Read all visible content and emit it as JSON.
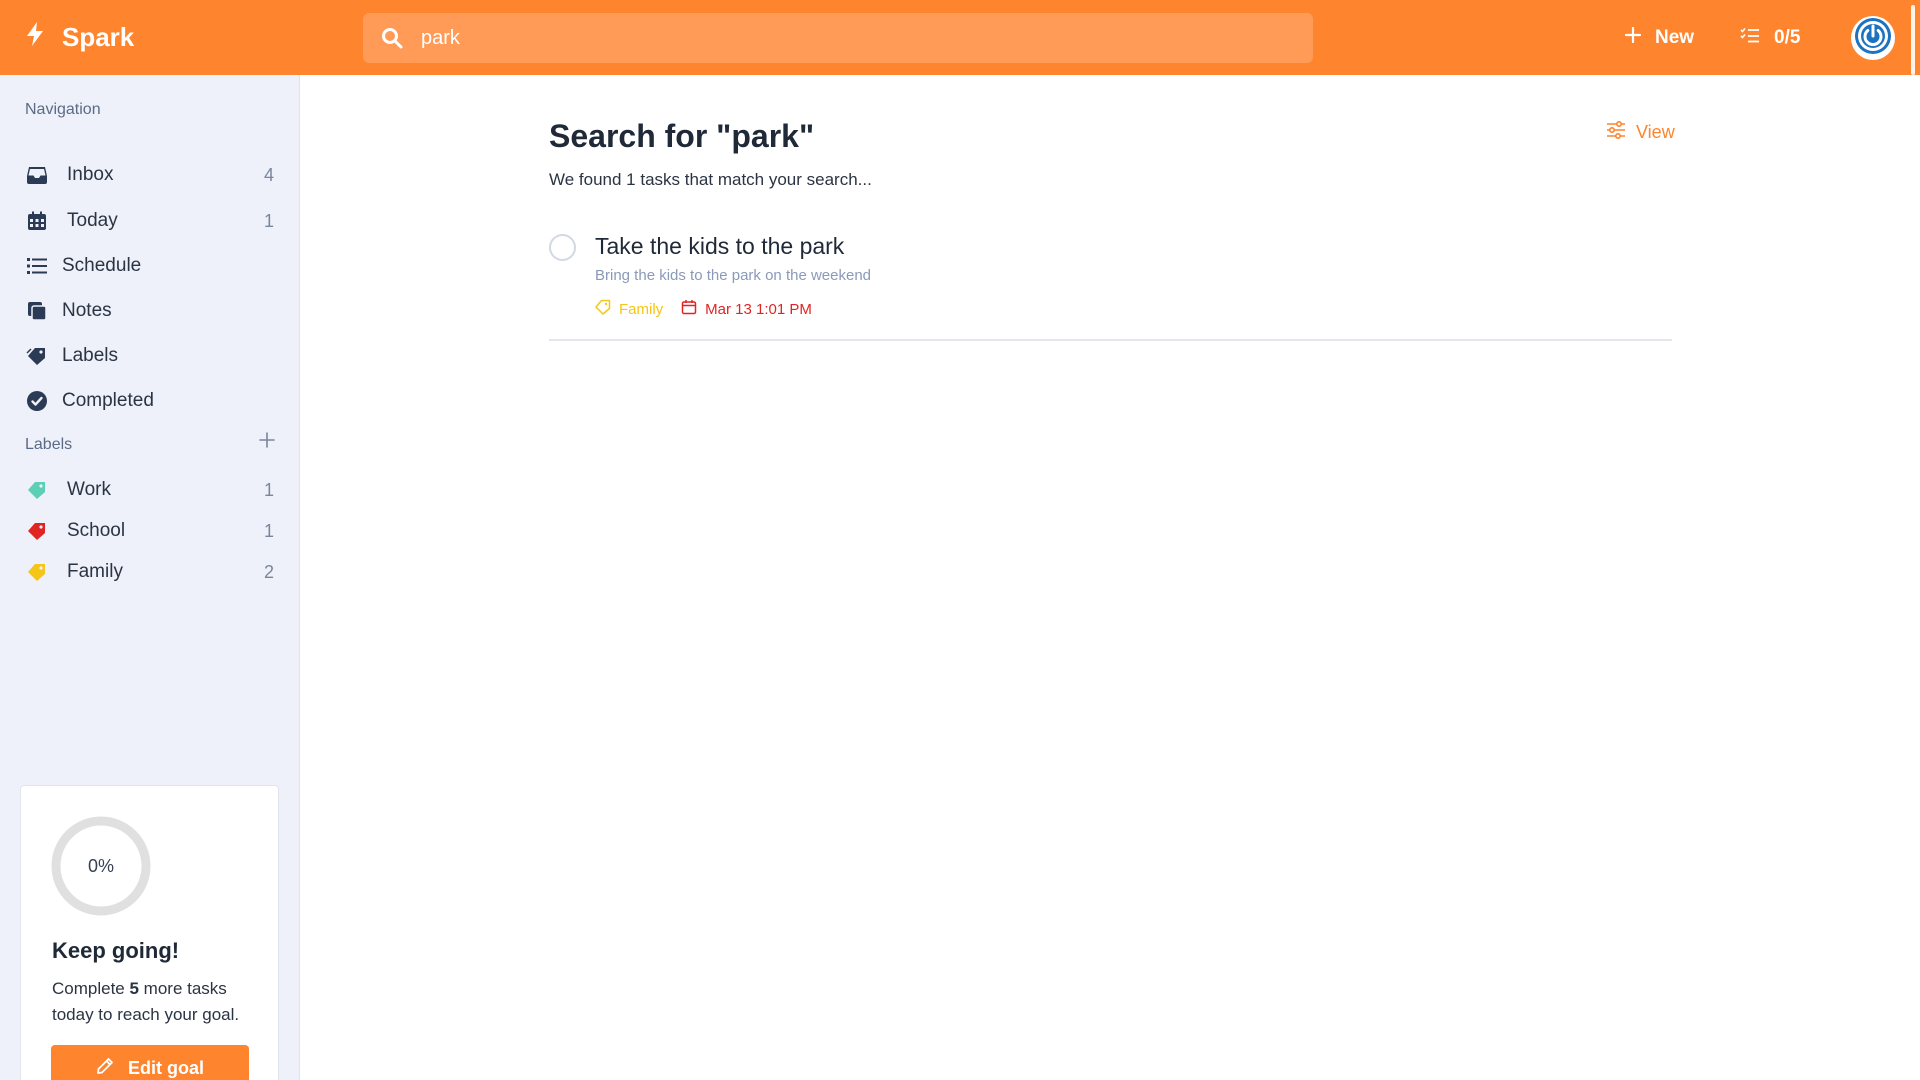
{
  "app": {
    "name": "Spark"
  },
  "search": {
    "value": "park"
  },
  "header": {
    "new_label": "New",
    "progress": "0/5"
  },
  "sidebar": {
    "nav_title": "Navigation",
    "nav_items": [
      {
        "label": "Inbox",
        "count": "4",
        "icon": "inbox-icon"
      },
      {
        "label": "Today",
        "count": "1",
        "icon": "calendar-icon"
      },
      {
        "label": "Schedule",
        "count": "",
        "icon": "list-icon"
      },
      {
        "label": "Notes",
        "count": "",
        "icon": "notes-icon"
      },
      {
        "label": "Labels",
        "count": "",
        "icon": "tags-icon"
      },
      {
        "label": "Completed",
        "count": "",
        "icon": "check-circle-icon"
      }
    ],
    "labels_title": "Labels",
    "labels": [
      {
        "label": "Work",
        "count": "1",
        "color": "#5ccfb5"
      },
      {
        "label": "School",
        "count": "1",
        "color": "#e02424"
      },
      {
        "label": "Family",
        "count": "2",
        "color": "#f5c518"
      }
    ]
  },
  "goal": {
    "percent": "0%",
    "title": "Keep going!",
    "text_before": "Complete ",
    "remaining": "5",
    "text_after": " more tasks today to reach your goal.",
    "button_label": "Edit goal"
  },
  "main": {
    "title": "Search for \"park\"",
    "subtitle": "We found 1 tasks that match your search...",
    "view_label": "View",
    "tasks": [
      {
        "title": "Take the kids to the park",
        "description": "Bring the kids to the park on the weekend",
        "label": "Family",
        "label_color": "#f5c518",
        "due": "Mar 13 1:01 PM",
        "due_color": "#e02424"
      }
    ]
  },
  "colors": {
    "accent": "#fe842e",
    "sidebar_bg": "#eef1f9"
  }
}
